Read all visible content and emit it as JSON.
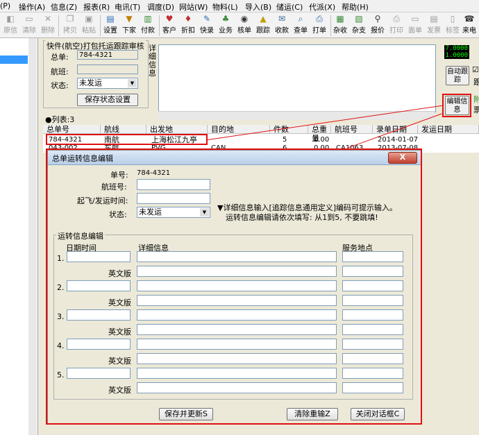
{
  "menu": {
    "items": [
      "(P)",
      "操作(A)",
      "信息(Z)",
      "报表(R)",
      "电讯(T)",
      "调度(D)",
      "网站(W)",
      "物料(L)",
      "导入(B)",
      "储运(C)",
      "代派(X)",
      "帮助(H)"
    ]
  },
  "toolbar": {
    "buttons": [
      "原信",
      "清除",
      "删除",
      "拷贝",
      "粘贴",
      "设置",
      "下家",
      "付款",
      "客户",
      "折扣",
      "快录",
      "业务",
      "核单",
      "跟踪",
      "收款",
      "查单",
      "打单",
      "杂收",
      "杂支",
      "报价",
      "打印",
      "面单",
      "发票",
      "标签",
      "来电"
    ]
  },
  "quick": {
    "title": "快件(航空)打包托运跟踪审核",
    "order_label": "总单:",
    "order_value": "784-4321",
    "flight_label": "航班:",
    "status_label": "状态:",
    "status_value": "未发运",
    "save_status_btn": "保存状态设置"
  },
  "detail": {
    "label": "详细信息"
  },
  "side": {
    "digit_top": "7.0000",
    "digit_bottom": "1.0000",
    "auto_track_btn": "自动跟踪",
    "edit_info_btn": "编辑信息",
    "cut_label_1": "跟",
    "cut_label_2": "附",
    "cut_label_3": "票"
  },
  "list": {
    "count_label": "●列表:3",
    "headers": [
      "总单号",
      "航线",
      "出发地",
      "目的地",
      "件数",
      "总重量",
      "航班号",
      "录单日期",
      "发运日期"
    ],
    "rows": [
      [
        "784-4321",
        "南航",
        "上海松江九亭",
        "",
        "5",
        "0.00",
        "",
        "2014-01-07",
        ""
      ],
      [
        "043-002",
        "东航",
        "PVG",
        "CAN",
        "6",
        "0.00",
        "CA1063",
        "2013-07-08",
        ""
      ]
    ]
  },
  "dialog": {
    "title": "总单运转信息编辑",
    "close": "X",
    "order_label": "单号:",
    "order_value": "784-4321",
    "flight_label": "航班号:",
    "time_label": "起飞/发运时间:",
    "status_label": "状态:",
    "status_value": "未发运",
    "hint_line1": "▼详细信息输入[追踪信息通用定义]编码可提示输入。",
    "hint_line2": "运转信息编辑请依次填写: 从1到5, 不要跳填!",
    "edit_group_title": "运转信息编辑",
    "col_time": "日期时间",
    "col_detail": "详细信息",
    "col_place": "服务地点",
    "english_label": "英文版",
    "row_numbers": [
      "1.",
      "2.",
      "3.",
      "4.",
      "5."
    ],
    "save_btn": "保存并更新S",
    "clear_btn": "清除重输Z",
    "close_btn": "关闭对话框C"
  }
}
